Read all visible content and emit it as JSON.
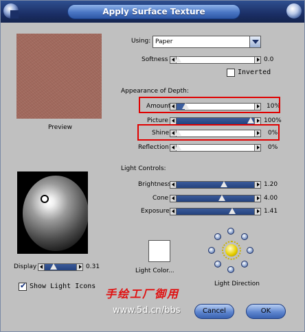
{
  "window": {
    "title": "Apply Surface Texture"
  },
  "preview": {
    "label": "Preview"
  },
  "using": {
    "label": "Using:",
    "value": "Paper"
  },
  "softness": {
    "label": "Softness",
    "value": "0.0",
    "level": 0.0
  },
  "inverted": {
    "label": "Inverted",
    "checked": false
  },
  "depth_section": {
    "label": "Appearance of Depth:"
  },
  "amount": {
    "label": "Amount",
    "value": "10%",
    "level": 0.1
  },
  "picture": {
    "label": "Picture",
    "value": "100%",
    "level": 1.0
  },
  "shine": {
    "label": "Shine",
    "value": "0%",
    "level": 0.0
  },
  "reflection": {
    "label": "Reflection",
    "value": "0%",
    "level": 0.0
  },
  "light_section": {
    "label": "Light Controls:"
  },
  "brightness": {
    "label": "Brightness",
    "value": "1.20",
    "level": 0.6
  },
  "cone": {
    "label": "Cone",
    "value": "4.00",
    "level": 0.55
  },
  "exposure": {
    "label": "Exposure",
    "value": "1.41",
    "level": 0.67
  },
  "display": {
    "label": "Display",
    "value": "0.31",
    "level": 0.31
  },
  "show_light_icons": {
    "label": "Show Light Icons",
    "checked": true
  },
  "light_color": {
    "label": "Light Color...",
    "color": "#ffffff"
  },
  "light_direction": {
    "label": "Light Direction"
  },
  "watermark": {
    "cn": "手绘工厂御用",
    "url": "www.5d.cn/bbs"
  },
  "buttons": {
    "cancel": "Cancel",
    "ok": "OK"
  },
  "colors": {
    "accent": "#3b5d9e",
    "highlight": "#e00000",
    "texture": "#a26a5e"
  }
}
